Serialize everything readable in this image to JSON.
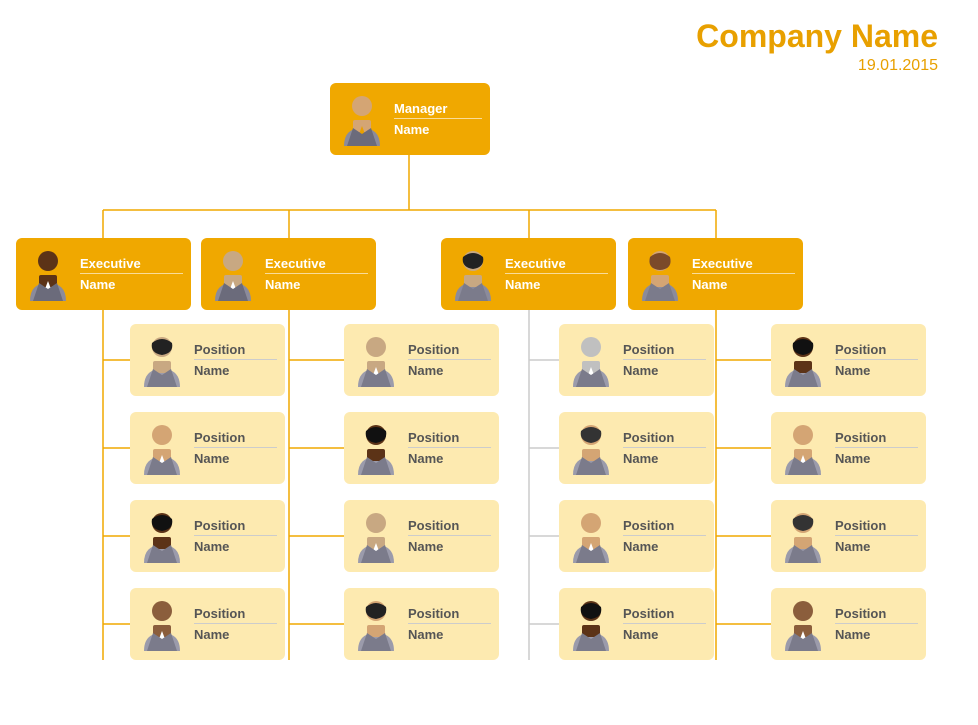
{
  "company": {
    "name": "Company Name",
    "date": "19.01.2015"
  },
  "manager": {
    "title": "Manager",
    "name": "Name",
    "avatar": "male_light"
  },
  "executives": [
    {
      "title": "Executive",
      "name": "Name",
      "avatar": "male_dark"
    },
    {
      "title": "Executive",
      "name": "Name",
      "avatar": "male_medium"
    },
    {
      "title": "Executive",
      "name": "Name",
      "avatar": "female_dark"
    },
    {
      "title": "Executive",
      "name": "Name",
      "avatar": "female_medium"
    }
  ],
  "positions": [
    [
      {
        "title": "Position",
        "name": "Name",
        "avatar": "female_dark2"
      },
      {
        "title": "Position",
        "name": "Name",
        "avatar": "female_light"
      },
      {
        "title": "Position",
        "name": "Name",
        "avatar": "female_dark3"
      },
      {
        "title": "Position",
        "name": "Name",
        "avatar": "male_brown"
      }
    ],
    [
      {
        "title": "Position",
        "name": "Name",
        "avatar": "male_light2"
      },
      {
        "title": "Position",
        "name": "Name",
        "avatar": "female_dark4"
      },
      {
        "title": "Position",
        "name": "Name",
        "avatar": "male_medium2"
      },
      {
        "title": "Position",
        "name": "Name",
        "avatar": "female_dark5"
      }
    ],
    [
      {
        "title": "Position",
        "name": "Name",
        "avatar": "male_gray"
      },
      {
        "title": "Position",
        "name": "Name",
        "avatar": "female_medium2"
      },
      {
        "title": "Position",
        "name": "Name",
        "avatar": "male_light3"
      },
      {
        "title": "Position",
        "name": "Name",
        "avatar": "female_dark6"
      }
    ],
    [
      {
        "title": "Position",
        "name": "Name",
        "avatar": "female_dark7"
      },
      {
        "title": "Position",
        "name": "Name",
        "avatar": "male_medium3"
      },
      {
        "title": "Position",
        "name": "Name",
        "avatar": "male_light4"
      },
      {
        "title": "Position",
        "name": "Name",
        "avatar": "male_brown2"
      }
    ]
  ]
}
